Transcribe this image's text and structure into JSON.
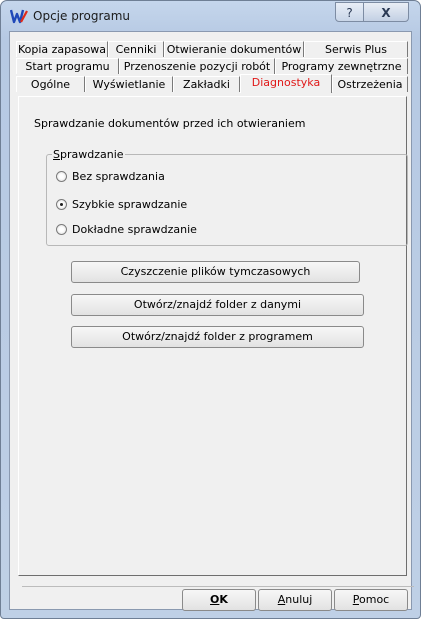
{
  "window": {
    "title": "Opcje programu"
  },
  "titlebar": {
    "help_label": "?",
    "close_label": "X"
  },
  "tabs": {
    "row1": [
      "Kopia zapasowa",
      "Cenniki",
      "Otwieranie dokumentów",
      "Serwis Plus"
    ],
    "row2": [
      "Start programu",
      "Przenoszenie pozycji robót",
      "Programy zewnętrzne"
    ],
    "row3": [
      "Ogólne",
      "Wyświetlanie",
      "Zakładki",
      "Diagnostyka",
      "Ostrzeżenia"
    ],
    "active": "Diagnostyka"
  },
  "panel": {
    "info": "Sprawdzanie dokumentów przed ich otwieraniem",
    "group": {
      "label_first": "S",
      "label_rest": "prawdzanie",
      "options": [
        "Bez sprawdzania",
        "Szybkie sprawdzanie",
        "Dokładne sprawdzanie"
      ],
      "selected": "Szybkie sprawdzanie"
    },
    "buttons": [
      "Czyszczenie plików tymczasowych",
      "Otwórz/znajdź folder z danymi",
      "Otwórz/znajdź folder z programem"
    ]
  },
  "footer": {
    "ok": {
      "first": "O",
      "rest": "K"
    },
    "cancel": {
      "first": "A",
      "rest": "nuluj"
    },
    "help": {
      "first": "P",
      "rest": "omoc"
    }
  },
  "colors": {
    "active_tab_text": "#e01818",
    "title_bar": "#bfd0e6"
  }
}
